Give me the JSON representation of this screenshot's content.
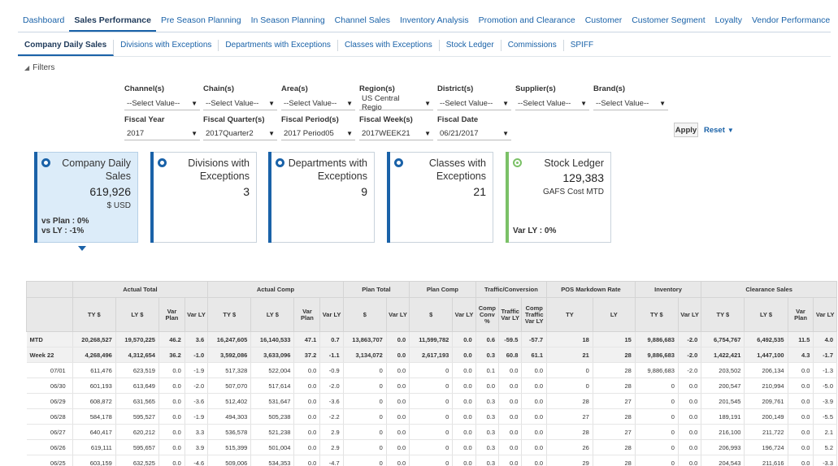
{
  "top_tabs": [
    "Dashboard",
    "Sales Performance",
    "Pre Season Planning",
    "In Season Planning",
    "Channel Sales",
    "Inventory Analysis",
    "Promotion and Clearance",
    "Customer",
    "Customer Segment",
    "Loyalty",
    "Vendor Performance"
  ],
  "sub_tabs": [
    "Company Daily Sales",
    "Divisions with Exceptions",
    "Departments with Exceptions",
    "Classes with Exceptions",
    "Stock Ledger",
    "Commissions",
    "SPIFF"
  ],
  "filters": {
    "title": "Filters",
    "row1": [
      {
        "label": "Channel(s)",
        "value": "--Select Value--"
      },
      {
        "label": "Chain(s)",
        "value": "--Select Value--"
      },
      {
        "label": "Area(s)",
        "value": "--Select Value--"
      },
      {
        "label": "Region(s)",
        "value": "US Central Regio"
      },
      {
        "label": "District(s)",
        "value": "--Select Value--"
      },
      {
        "label": "Supplier(s)",
        "value": "--Select Value--"
      },
      {
        "label": "Brand(s)",
        "value": "--Select Value--"
      }
    ],
    "row2": [
      {
        "label": "Fiscal Year",
        "value": "2017"
      },
      {
        "label": "Fiscal Quarter(s)",
        "value": "2017Quarter2"
      },
      {
        "label": "Fiscal Period(s)",
        "value": "2017 Period05"
      },
      {
        "label": "Fiscal Week(s)",
        "value": "2017WEEK21"
      },
      {
        "label": "Fiscal Date",
        "value": "06/21/2017"
      }
    ],
    "apply": "Apply",
    "reset": "Reset"
  },
  "tiles": [
    {
      "title_l1": "Company Daily",
      "title_l2": "Sales",
      "value": "619,926",
      "unit": "$ USD",
      "foot1": "vs Plan : 0%",
      "foot2": "vs LY : -1%"
    },
    {
      "title_l1": "Divisions with",
      "title_l2": "Exceptions",
      "value": "3"
    },
    {
      "title_l1": "Departments with",
      "title_l2": "Exceptions",
      "value": "9"
    },
    {
      "title_l1": "Classes with",
      "title_l2": "Exceptions",
      "value": "21"
    },
    {
      "title_l1": "Stock Ledger",
      "value": "129,383",
      "unit": "GAFS Cost MTD",
      "foot1": "Var LY : 0%"
    }
  ],
  "table": {
    "groups": [
      "Actual Total",
      "Actual Comp",
      "Plan Total",
      "Plan Comp",
      "Traffic/Conversion",
      "POS Markdown Rate",
      "Inventory",
      "Clearance Sales"
    ],
    "columns": [
      "TY $",
      "LY $",
      "Var Plan",
      "Var LY",
      "TY $",
      "LY $",
      "Var Plan",
      "Var LY",
      "$",
      "Var LY",
      "$",
      "Var LY",
      "Comp Conv %",
      "Traffic Var LY",
      "Comp Traffic Var LY",
      "TY",
      "LY",
      "TY $",
      "Var LY",
      "TY $",
      "LY $",
      "Var Plan",
      "Var LY"
    ],
    "rows": [
      [
        "MTD",
        "20,268,527",
        "19,570,225",
        "46.2",
        "3.6",
        "16,247,605",
        "16,140,533",
        "47.1",
        "0.7",
        "13,863,707",
        "0.0",
        "11,599,782",
        "0.0",
        "0.6",
        "-59.5",
        "-57.7",
        "18",
        "15",
        "9,886,683",
        "-2.0",
        "6,754,767",
        "6,492,535",
        "11.5",
        "4.0"
      ],
      [
        "Week 22",
        "4,268,496",
        "4,312,654",
        "36.2",
        "-1.0",
        "3,592,086",
        "3,633,096",
        "37.2",
        "-1.1",
        "3,134,072",
        "0.0",
        "2,617,193",
        "0.0",
        "0.3",
        "60.8",
        "61.1",
        "21",
        "28",
        "9,886,683",
        "-2.0",
        "1,422,421",
        "1,447,100",
        "4.3",
        "-1.7"
      ],
      [
        "07/01",
        "611,476",
        "623,519",
        "0.0",
        "-1.9",
        "517,328",
        "522,004",
        "0.0",
        "-0.9",
        "0",
        "0.0",
        "0",
        "0.0",
        "0.1",
        "0.0",
        "0.0",
        "0",
        "28",
        "9,886,683",
        "-2.0",
        "203,502",
        "206,134",
        "0.0",
        "-1.3"
      ],
      [
        "06/30",
        "601,193",
        "613,649",
        "0.0",
        "-2.0",
        "507,070",
        "517,614",
        "0.0",
        "-2.0",
        "0",
        "0.0",
        "0",
        "0.0",
        "0.0",
        "0.0",
        "0.0",
        "0",
        "28",
        "0",
        "0.0",
        "200,547",
        "210,994",
        "0.0",
        "-5.0"
      ],
      [
        "06/29",
        "608,872",
        "631,565",
        "0.0",
        "-3.6",
        "512,402",
        "531,647",
        "0.0",
        "-3.6",
        "0",
        "0.0",
        "0",
        "0.0",
        "0.3",
        "0.0",
        "0.0",
        "28",
        "27",
        "0",
        "0.0",
        "201,545",
        "209,761",
        "0.0",
        "-3.9"
      ],
      [
        "06/28",
        "584,178",
        "595,527",
        "0.0",
        "-1.9",
        "494,303",
        "505,238",
        "0.0",
        "-2.2",
        "0",
        "0.0",
        "0",
        "0.0",
        "0.3",
        "0.0",
        "0.0",
        "27",
        "28",
        "0",
        "0.0",
        "189,191",
        "200,149",
        "0.0",
        "-5.5"
      ],
      [
        "06/27",
        "640,417",
        "620,212",
        "0.0",
        "3.3",
        "536,578",
        "521,238",
        "0.0",
        "2.9",
        "0",
        "0.0",
        "0",
        "0.0",
        "0.3",
        "0.0",
        "0.0",
        "28",
        "27",
        "0",
        "0.0",
        "216,100",
        "211,722",
        "0.0",
        "2.1"
      ],
      [
        "06/26",
        "619,111",
        "595,657",
        "0.0",
        "3.9",
        "515,399",
        "501,004",
        "0.0",
        "2.9",
        "0",
        "0.0",
        "0",
        "0.0",
        "0.3",
        "0.0",
        "0.0",
        "26",
        "28",
        "0",
        "0.0",
        "206,993",
        "196,724",
        "0.0",
        "5.2"
      ],
      [
        "06/25",
        "603,159",
        "632,525",
        "0.0",
        "-4.6",
        "509,006",
        "534,353",
        "0.0",
        "-4.7",
        "0",
        "0.0",
        "0",
        "0.0",
        "0.3",
        "0.0",
        "0.0",
        "29",
        "28",
        "0",
        "0.0",
        "204,543",
        "211,616",
        "0.0",
        "-3.3"
      ]
    ]
  }
}
